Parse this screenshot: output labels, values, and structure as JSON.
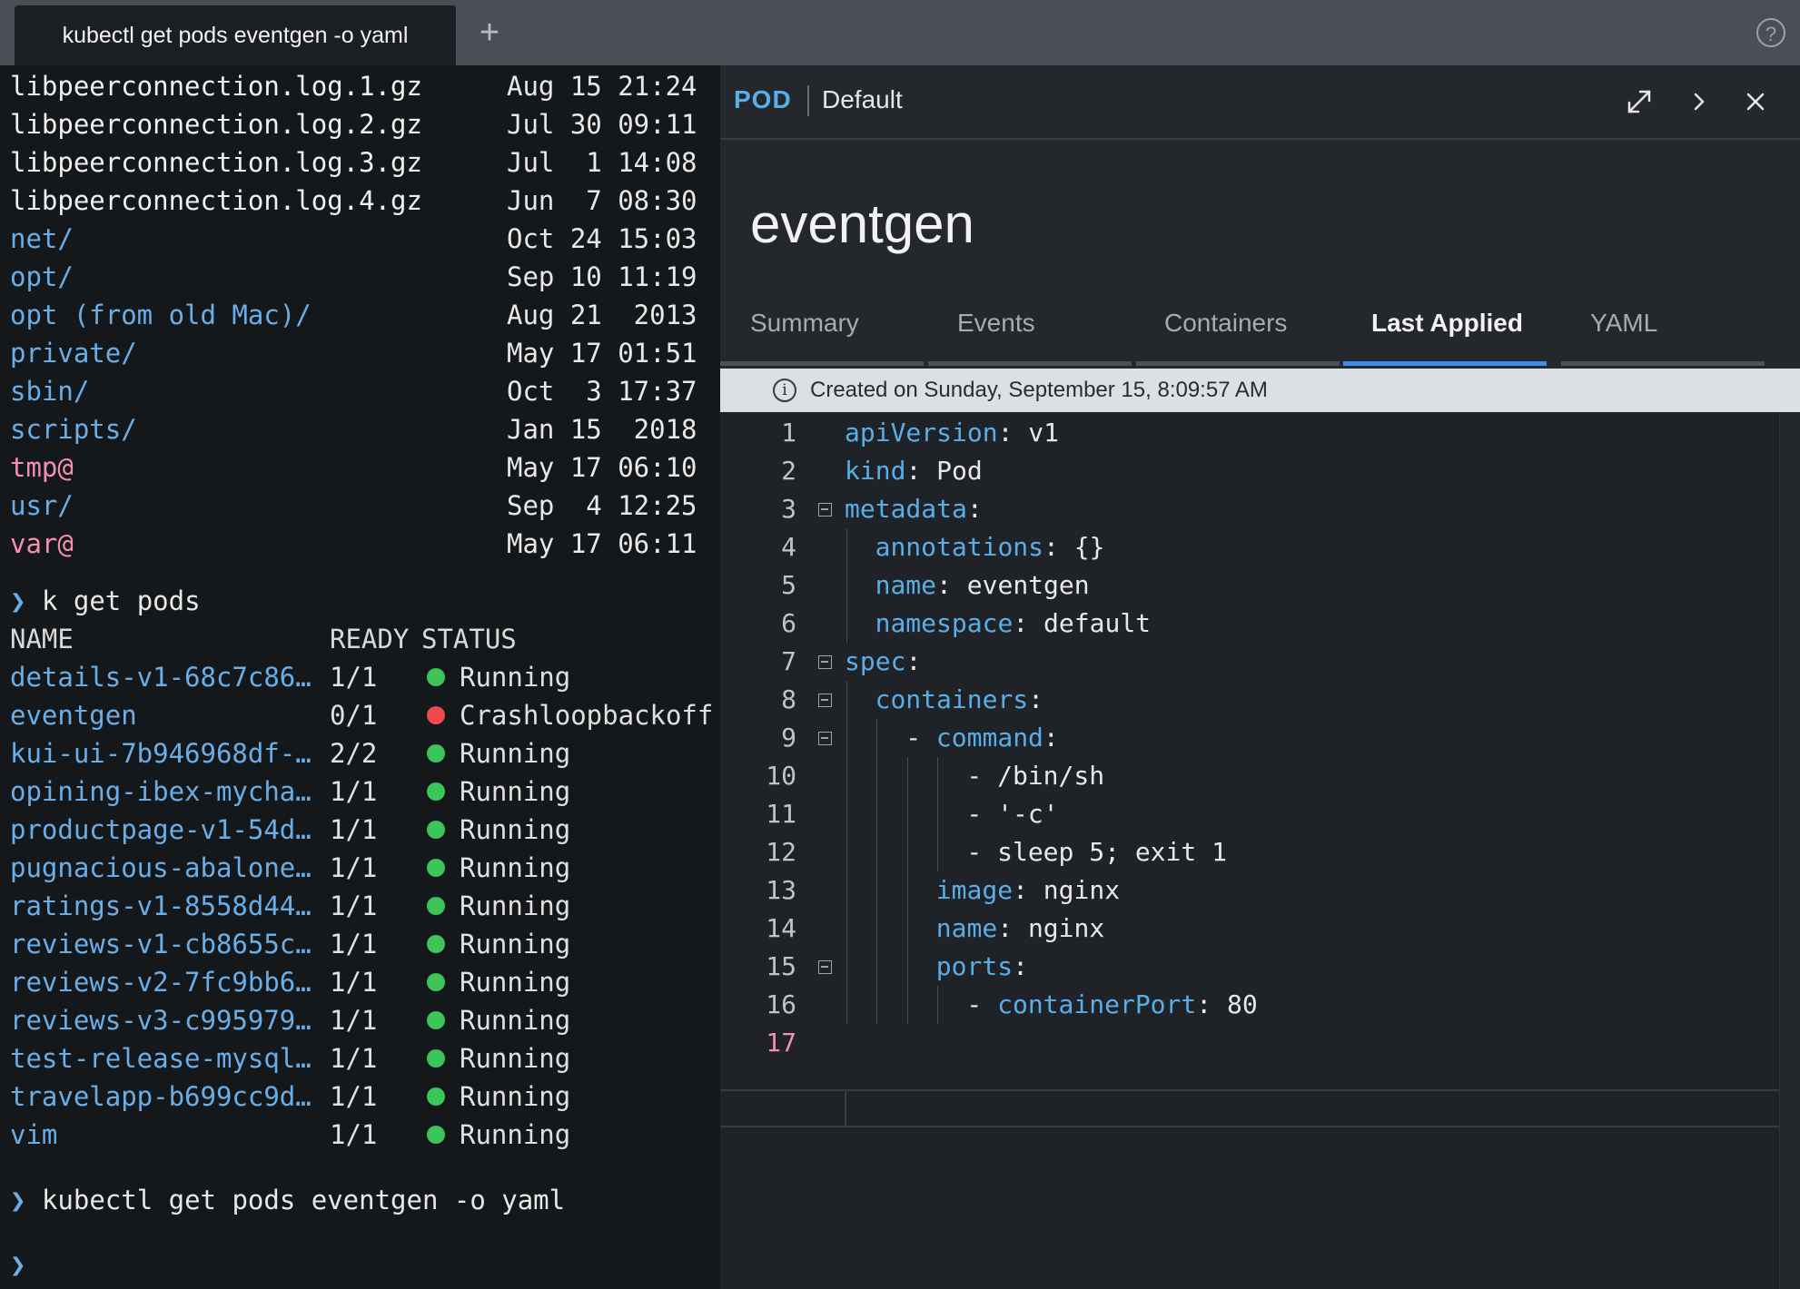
{
  "tabbar": {
    "active_tab": "kubectl get pods eventgen -o yaml",
    "new_tab_glyph": "+",
    "help_glyph": "?"
  },
  "terminal": {
    "file_listing": [
      {
        "name": "libpeerconnection.log.1.gz",
        "date": "Aug 15 21:24",
        "kind": "file"
      },
      {
        "name": "libpeerconnection.log.2.gz",
        "date": "Jul 30 09:11",
        "kind": "file"
      },
      {
        "name": "libpeerconnection.log.3.gz",
        "date": "Jul  1 14:08",
        "kind": "file"
      },
      {
        "name": "libpeerconnection.log.4.gz",
        "date": "Jun  7 08:30",
        "kind": "file"
      },
      {
        "name": "net/",
        "date": "Oct 24 15:03",
        "kind": "dir"
      },
      {
        "name": "opt/",
        "date": "Sep 10 11:19",
        "kind": "dir"
      },
      {
        "name": "opt (from old Mac)/",
        "date": "Aug 21  2013",
        "kind": "dir"
      },
      {
        "name": "private/",
        "date": "May 17 01:51",
        "kind": "dir"
      },
      {
        "name": "sbin/",
        "date": "Oct  3 17:37",
        "kind": "dir"
      },
      {
        "name": "scripts/",
        "date": "Jan 15  2018",
        "kind": "dir"
      },
      {
        "name": "tmp@",
        "date": "May 17 06:10",
        "kind": "link"
      },
      {
        "name": "usr/",
        "date": "Sep  4 12:25",
        "kind": "dir"
      },
      {
        "name": "var@",
        "date": "May 17 06:11",
        "kind": "link"
      }
    ],
    "prompt_glyph": "❯",
    "command1": "k get pods",
    "headers": {
      "name": "NAME",
      "ready": "READY",
      "status": "STATUS"
    },
    "pods": [
      {
        "name": "details-v1-68c7c86…",
        "ready": "1/1",
        "status": "Running",
        "color": "#3cc35a"
      },
      {
        "name": "eventgen",
        "ready": "0/1",
        "status": "Crashloopbackoff",
        "color": "#f0484e"
      },
      {
        "name": "kui-ui-7b946968df-…",
        "ready": "2/2",
        "status": "Running",
        "color": "#3cc35a"
      },
      {
        "name": "opining-ibex-mycha…",
        "ready": "1/1",
        "status": "Running",
        "color": "#3cc35a"
      },
      {
        "name": "productpage-v1-54d…",
        "ready": "1/1",
        "status": "Running",
        "color": "#3cc35a"
      },
      {
        "name": "pugnacious-abalone…",
        "ready": "1/1",
        "status": "Running",
        "color": "#3cc35a"
      },
      {
        "name": "ratings-v1-8558d44…",
        "ready": "1/1",
        "status": "Running",
        "color": "#3cc35a"
      },
      {
        "name": "reviews-v1-cb8655c…",
        "ready": "1/1",
        "status": "Running",
        "color": "#3cc35a"
      },
      {
        "name": "reviews-v2-7fc9bb6…",
        "ready": "1/1",
        "status": "Running",
        "color": "#3cc35a"
      },
      {
        "name": "reviews-v3-c995979…",
        "ready": "1/1",
        "status": "Running",
        "color": "#3cc35a"
      },
      {
        "name": "test-release-mysql…",
        "ready": "1/1",
        "status": "Running",
        "color": "#3cc35a"
      },
      {
        "name": "travelapp-b699cc9d…",
        "ready": "1/1",
        "status": "Running",
        "color": "#3cc35a"
      },
      {
        "name": "vim",
        "ready": "1/1",
        "status": "Running",
        "color": "#3cc35a"
      }
    ],
    "command2": "kubectl get pods eventgen -o yaml"
  },
  "panel": {
    "kind": "POD",
    "namespace": "Default",
    "title": "eventgen",
    "tabs": [
      "Summary",
      "Events",
      "Containers",
      "Last Applied",
      "YAML"
    ],
    "active_tab": "Last Applied",
    "info": "Created on Sunday, September 15, 8:09:57 AM",
    "yaml_lines": [
      {
        "n": "1",
        "key": "apiVersion",
        "rest": ": v1",
        "prefix": ""
      },
      {
        "n": "2",
        "key": "kind",
        "rest": ": Pod",
        "prefix": ""
      },
      {
        "n": "3",
        "key": "metadata",
        "rest": ":",
        "prefix": ""
      },
      {
        "n": "4",
        "key": "annotations",
        "rest": ": {}",
        "prefix": ""
      },
      {
        "n": "5",
        "key": "name",
        "rest": ": eventgen",
        "prefix": ""
      },
      {
        "n": "6",
        "key": "namespace",
        "rest": ": default",
        "prefix": ""
      },
      {
        "n": "7",
        "key": "spec",
        "rest": ":",
        "prefix": ""
      },
      {
        "n": "8",
        "key": "containers",
        "rest": ":",
        "prefix": ""
      },
      {
        "n": "9",
        "key": "command",
        "rest": ":",
        "prefix": "- "
      },
      {
        "n": "10",
        "key": "",
        "rest": "- /bin/sh",
        "prefix": ""
      },
      {
        "n": "11",
        "key": "",
        "rest": "- '-c'",
        "prefix": ""
      },
      {
        "n": "12",
        "key": "",
        "rest": "- sleep 5; exit 1",
        "prefix": ""
      },
      {
        "n": "13",
        "key": "image",
        "rest": ": nginx",
        "prefix": ""
      },
      {
        "n": "14",
        "key": "name",
        "rest": ": nginx",
        "prefix": ""
      },
      {
        "n": "15",
        "key": "ports",
        "rest": ":",
        "prefix": ""
      },
      {
        "n": "16",
        "key": "containerPort",
        "rest": ": 80",
        "prefix": "- "
      },
      {
        "n": "17",
        "key": "",
        "rest": "",
        "prefix": ""
      }
    ]
  }
}
